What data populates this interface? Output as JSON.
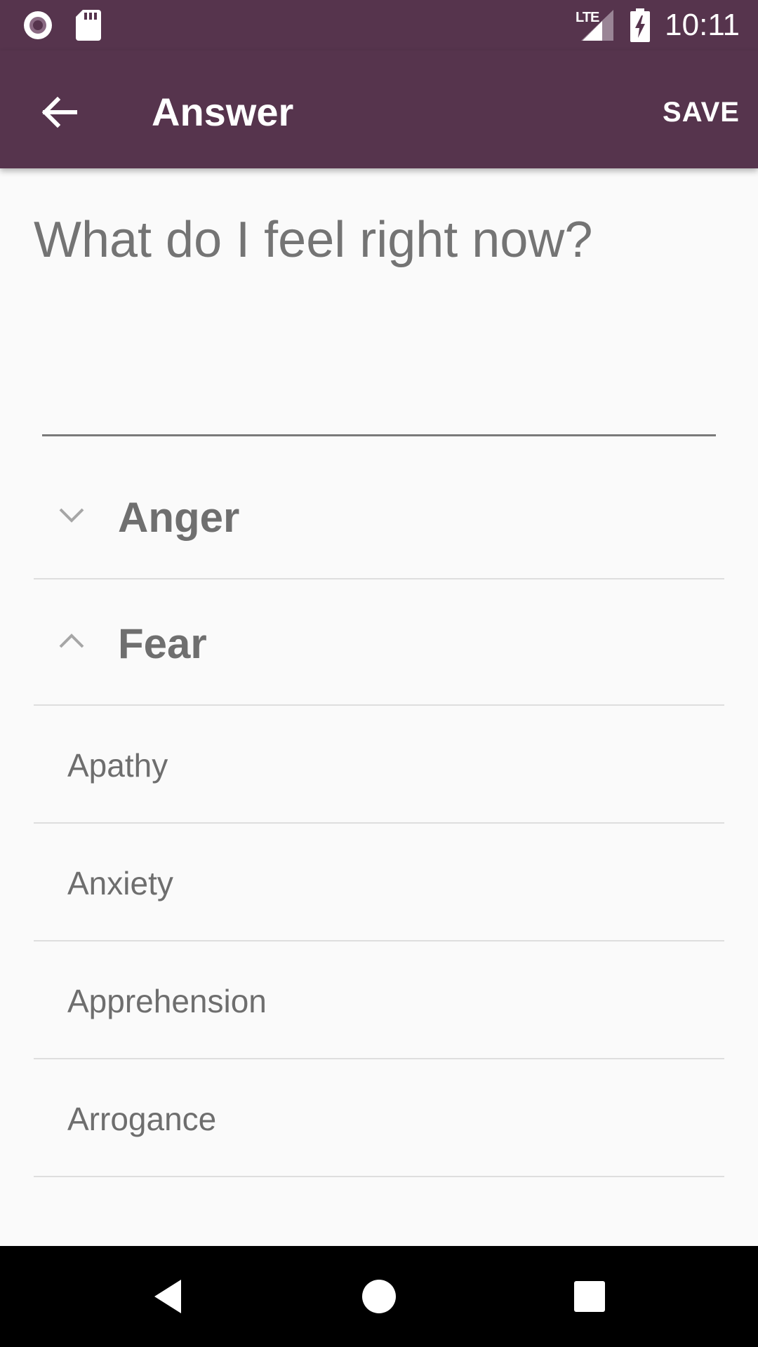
{
  "status_bar": {
    "time": "10:11",
    "network_label": "LTE",
    "icons": [
      "record-icon",
      "sd-card-icon",
      "lte-signal-icon",
      "battery-charging-icon"
    ]
  },
  "app_bar": {
    "title": "Answer",
    "save_label": "SAVE",
    "back_icon": "arrow-back-icon",
    "color": "#56344d"
  },
  "question": "What do I feel right now?",
  "answer_input": {
    "value": "",
    "placeholder": ""
  },
  "groups": [
    {
      "label": "Anger",
      "expanded": false
    },
    {
      "label": "Fear",
      "expanded": true,
      "items": [
        "Apathy",
        "Anxiety",
        "Apprehension",
        "Arrogance"
      ]
    }
  ],
  "nav_bar": {
    "icons": [
      "back-triangle-icon",
      "home-circle-icon",
      "recents-square-icon"
    ]
  }
}
